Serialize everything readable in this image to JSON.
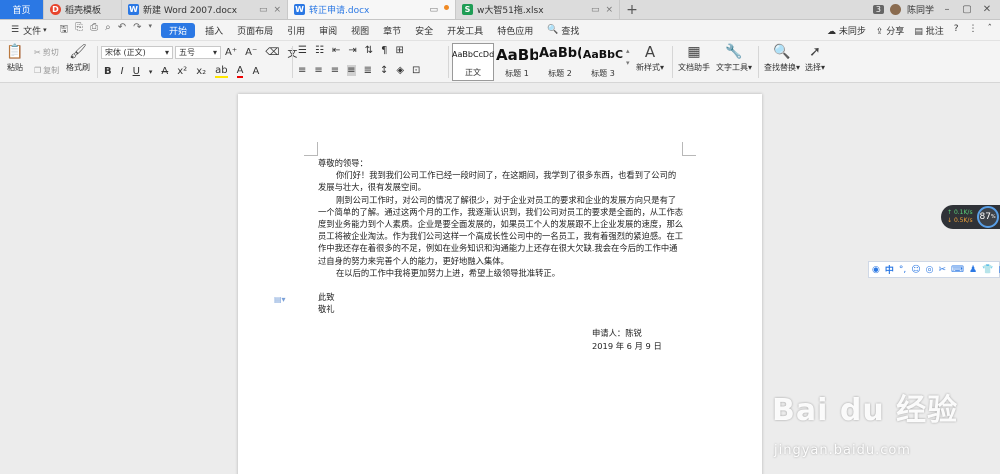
{
  "tabs": [
    {
      "label": "首页",
      "active": false
    },
    {
      "label": "稻壳模板",
      "icon": "daoke-icon"
    },
    {
      "label": "新建 Word 2007.docx",
      "icon": "word-doc-icon"
    },
    {
      "label": "转正申请.docx",
      "icon": "word-doc-icon",
      "active": true
    },
    {
      "label": "w大智51拖.xlsx",
      "icon": "excel-doc-icon"
    }
  ],
  "titlebar": {
    "count": "3",
    "user": "陈同学"
  },
  "menu": {
    "file": "文件",
    "items": [
      "开始",
      "插入",
      "页面布局",
      "引用",
      "审阅",
      "视图",
      "章节",
      "安全",
      "开发工具",
      "特色应用"
    ],
    "active": "开始",
    "search": "查找",
    "right": [
      "未同步",
      "分享",
      "批注"
    ]
  },
  "ribbon": {
    "paste": "粘贴",
    "cut": "剪切",
    "copy": "复制",
    "format_painter": "格式刷",
    "font_name": "宋体 (正文)",
    "font_size": "五号",
    "styles": [
      {
        "preview": "AaBbCcDd",
        "name": "正文"
      },
      {
        "preview": "AaBb",
        "name": "标题 1"
      },
      {
        "preview": "AaBb(",
        "name": "标题 2"
      },
      {
        "preview": "AaBbC",
        "name": "标题 3"
      }
    ],
    "new_style": "新样式",
    "doc_assistant": "文档助手",
    "text_tools": "文字工具",
    "find_replace": "查找替换",
    "select": "选择"
  },
  "document": {
    "salutation": "尊敬的领导：",
    "paragraphs": [
      "你们好！我到我们公司工作已经一段时间了，在这期间，我学到了很多东西，也看到了公司的发展与壮大，很有发展空间。",
      "刚到公司工作时，对公司的情况了解很少，对于企业对员工的要求和企业的发展方向只是有了一个简单的了解。通过这两个月的工作，我逐渐认识到，我们公司对员工的要求是全面的，从工作态度到业务能力到个人素质。企业是要全面发展的，如果员工个人的发展跟不上企业发展的速度，那么员工将被企业淘汰。作为我们公司这样一个高成长性公司中的一名员工，我有着强烈的紧迫感。在工作中我还存在着很多的不足，例如在业务知识和沟通能力上还存在很大欠缺.我会在今后的工作中通过自身的努力来完善个人的能力，更好地融入集体。",
      "在以后的工作中我将更加努力上进，希望上级领导批准转正。"
    ],
    "closing1": "此致",
    "closing2": "敬礼",
    "applicant": "申请人：陈锐",
    "date": "2019 年 6 月 9 日"
  },
  "widgets": {
    "net_up": "0.1",
    "net_down": "0.5",
    "net_unit": "K/s",
    "cpu_pct": "87",
    "cpu_unit": "%",
    "ime_lang": "中"
  },
  "watermark": {
    "logo": "Bai du 经验",
    "url": "jingyan.baidu.com"
  },
  "colors": {
    "accent": "#2b78e4",
    "word": "#2b78e4",
    "excel": "#1f9d55",
    "daoke": "#e8442c"
  }
}
